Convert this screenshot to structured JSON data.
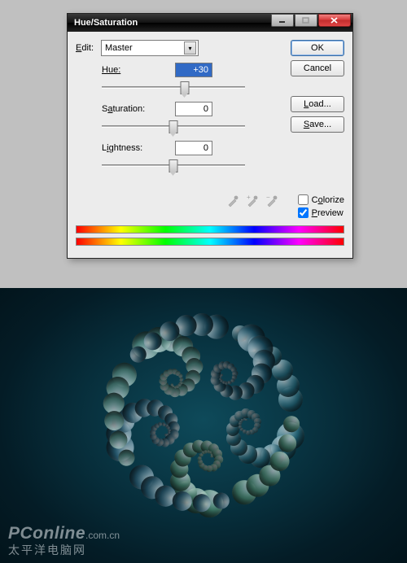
{
  "dialog": {
    "title": "Hue/Saturation",
    "edit_label": "Edit:",
    "edit_value": "Master",
    "hue": {
      "label": "Hue:",
      "value": "+30",
      "pos_pct": 58
    },
    "saturation": {
      "label": "Saturation:",
      "value": "0",
      "pos_pct": 50
    },
    "lightness": {
      "label": "Lightness:",
      "value": "0",
      "pos_pct": 50
    },
    "buttons": {
      "ok": "OK",
      "cancel": "Cancel",
      "load": "Load...",
      "save": "Save..."
    },
    "checks": {
      "colorize": {
        "label": "Colorize",
        "checked": false
      },
      "preview": {
        "label": "Preview",
        "checked": true
      }
    },
    "eyedroppers": [
      "eyedropper",
      "eyedropper-add",
      "eyedropper-subtract"
    ]
  },
  "artwork": {
    "watermark_brand": "PConline",
    "watermark_domain": ".com.cn",
    "watermark_cn": "太平洋电脑网",
    "arm_colors": [
      "#2b7d94",
      "#4f9a84",
      "#2e6e8a",
      "#5aa19a",
      "#226078"
    ]
  }
}
